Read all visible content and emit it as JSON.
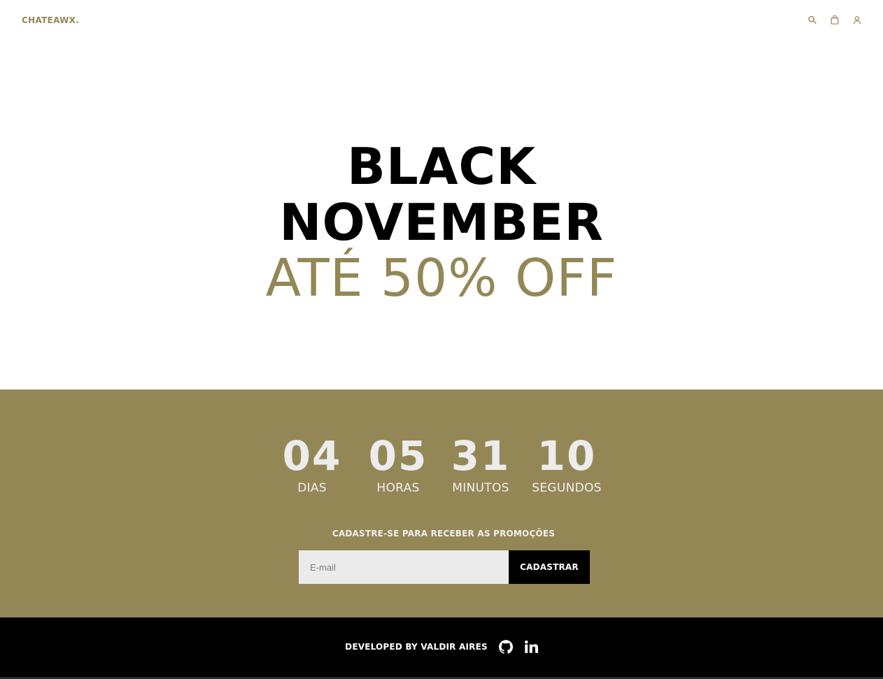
{
  "header": {
    "logo": "CHATEAWX.",
    "icons": [
      "search-icon",
      "shopping-bag-icon",
      "user-icon"
    ]
  },
  "hero": {
    "line1": "BLACK",
    "line2": "NOVEMBER",
    "line3": "ATÉ 50% OFF"
  },
  "countdown": {
    "days": {
      "value": "04",
      "label": "DIAS"
    },
    "hours": {
      "value": "05",
      "label": "HORAS"
    },
    "minutes": {
      "value": "31",
      "label": "MINUTOS"
    },
    "seconds": {
      "value": "10",
      "label": "SEGUNDOS"
    }
  },
  "signup": {
    "title": "CADASTRE-SE PARA RECEBER AS PROMOÇÕES",
    "email_placeholder": "E-mail",
    "email_value": "",
    "button_label": "CADASTRAR"
  },
  "footer": {
    "credit": "DEVELOPED BY VALDIR AIRES",
    "social_icons": [
      "github-icon",
      "linkedin-icon"
    ]
  },
  "colors": {
    "accent": "#948756",
    "dark": "#000000",
    "light_text": "#efefef",
    "input_bg": "#ebebeb"
  }
}
